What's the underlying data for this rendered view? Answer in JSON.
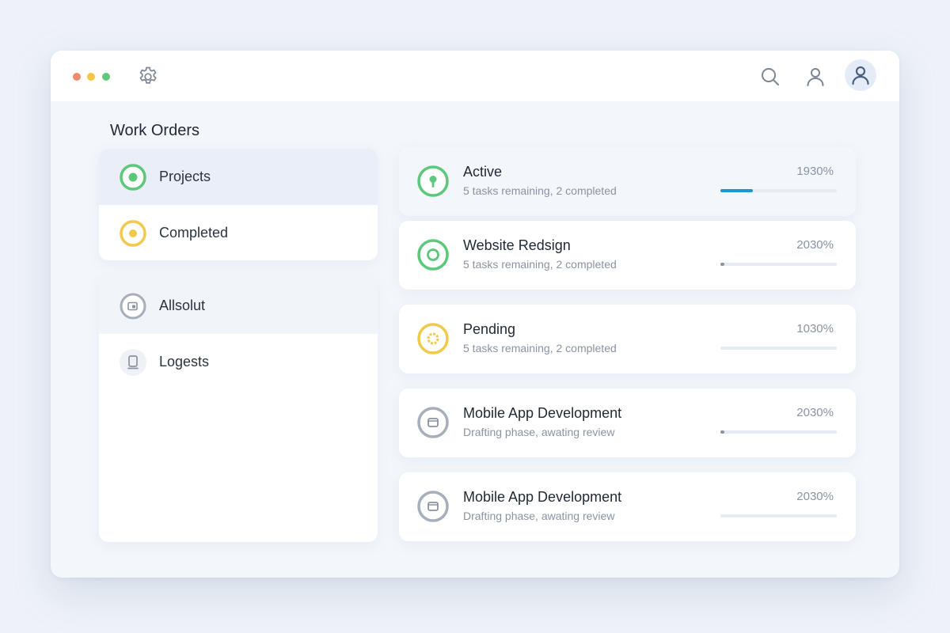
{
  "window": {
    "traffic_lights": [
      "#f08a6e",
      "#f5c643",
      "#5fc97a"
    ]
  },
  "header": {
    "icons": [
      "gear-icon",
      "search-icon",
      "user-icon",
      "avatar-user-icon"
    ]
  },
  "sidebar": {
    "title": "Work Orders",
    "groups": [
      {
        "items": [
          {
            "label": "Projects",
            "icon": "status-ring-green-icon",
            "active": true
          },
          {
            "label": "Completed",
            "icon": "status-ring-yellow-icon"
          }
        ]
      },
      {
        "items": [
          {
            "label": "Allsolut",
            "icon": "folder-badge-gray-icon"
          },
          {
            "label": "Logests",
            "icon": "document-icon"
          }
        ]
      }
    ]
  },
  "orders": [
    {
      "name": "Active",
      "desc": "5 tasks remaining, 2 completed",
      "percent_text": "1930%",
      "icon": "pin-ring-green-icon",
      "progress": 0.28
    },
    {
      "name": "Website Redsign",
      "desc": "5 tasks remaining, 2 completed",
      "percent_text": "2030%",
      "icon": "ring-green-icon",
      "progress": 0.03
    },
    {
      "name": "Pending",
      "desc": "5 tasks remaining, 2 completed",
      "percent_text": "1030%",
      "icon": "gear-ring-yellow-icon",
      "progress": 0.0
    },
    {
      "name": "Mobile App Development",
      "desc": "Drafting phase, awating review",
      "percent_text": "2030%",
      "icon": "folder-ring-gray-icon",
      "progress": 0.02
    },
    {
      "name": "Mobile App Development",
      "desc": "Drafting phase, awating review",
      "percent_text": "2030%",
      "icon": "folder-ring-gray-icon",
      "progress": 0.0
    }
  ],
  "colors": {
    "green": "#5cc97a",
    "yellow": "#f2c94c",
    "gray": "#a7afba",
    "accent": "#1e95cf"
  }
}
